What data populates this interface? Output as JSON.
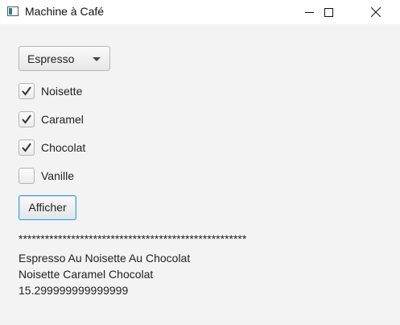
{
  "window": {
    "title": "Machine à Café",
    "icon": "java-app-icon",
    "controls": [
      "minimize-icon",
      "maximize-icon",
      "close-icon"
    ]
  },
  "form": {
    "drink_select": {
      "value": "Espresso"
    },
    "options": [
      {
        "label": "Noisette",
        "checked": true
      },
      {
        "label": "Caramel",
        "checked": true
      },
      {
        "label": "Chocolat",
        "checked": true
      },
      {
        "label": "Vanille",
        "checked": false
      }
    ],
    "show_button": "Afficher"
  },
  "output": {
    "separator": "****************************************************",
    "line1": "Espresso Au Noisette Au Chocolat",
    "line2": "Noisette Caramel Chocolat",
    "price": "15.299999999999999"
  },
  "colors": {
    "accent_focus": "#3d9ce0",
    "background": "#f3f3f3"
  }
}
